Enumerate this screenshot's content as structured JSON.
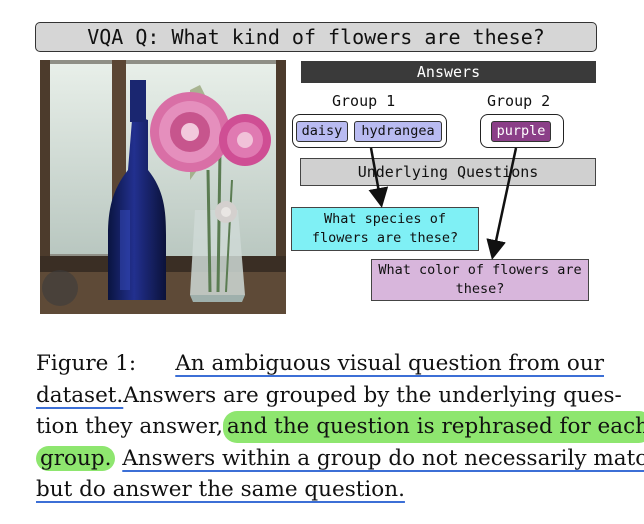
{
  "figure": {
    "question": "VQA Q: What kind of flowers are these?",
    "answers_header": "Answers",
    "groups": [
      {
        "label": "Group 1",
        "answers": [
          "daisy",
          "hydrangea"
        ]
      },
      {
        "label": "Group 2",
        "answers": [
          "purple"
        ]
      }
    ],
    "underlying_header": "Underlying Questions",
    "underlying_questions": [
      "What species of flowers are these?",
      "What color of flowers are these?"
    ],
    "colors": {
      "chip_blue": "#b9bbf1",
      "chip_purple": "#8b3f88",
      "q1_box": "#7ff0f5",
      "q2_box": "#d8b6dc",
      "highlight_green": "#8ee66f",
      "underline_blue": "#3c6fd6"
    }
  },
  "caption": {
    "line1_prefix": "Figure 1:",
    "line1_rest": "An ambiguous visual question from our",
    "line2_ul": "dataset.",
    "line2_rest": "Answers are grouped by the underlying ques-",
    "line3_a": "tion they answer,",
    "line3_hl": "and the question is rephrased for each",
    "line4_hl": "group.",
    "line4_ul": "Answers within a group do not necessarily match,",
    "line5_ul": "but do answer the same question."
  }
}
